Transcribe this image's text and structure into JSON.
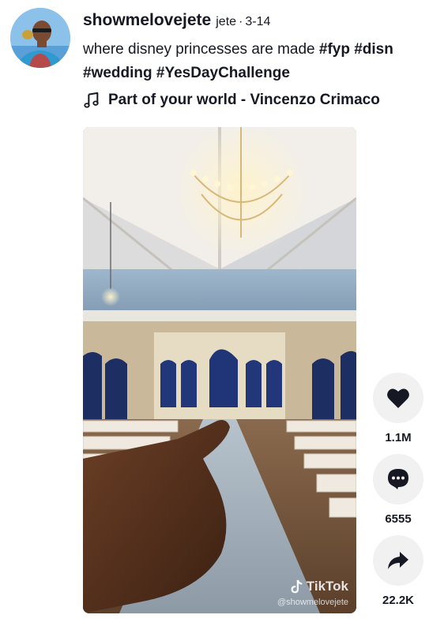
{
  "author": {
    "username": "showmelovejete",
    "nickname": "jete",
    "separator": "·",
    "date": "3-14"
  },
  "caption": {
    "text": "where disney princesses are made",
    "hashtags": [
      "#fyp",
      "#disn",
      "#wedding",
      "#YesDayChallenge"
    ]
  },
  "music": {
    "icon": "music-note-icon",
    "title": "Part of your world - Vincenzo Crimaco"
  },
  "video": {
    "watermark_brand": "TikTok",
    "watermark_handle": "@showmelovejete"
  },
  "actions": {
    "like": {
      "icon": "heart-icon",
      "count": "1.1M"
    },
    "comment": {
      "icon": "comment-icon",
      "count": "6555"
    },
    "share": {
      "icon": "share-arrow-icon",
      "count": "22.2K"
    }
  },
  "colors": {
    "text": "#161823",
    "action_bg": "#f1f1f2"
  }
}
